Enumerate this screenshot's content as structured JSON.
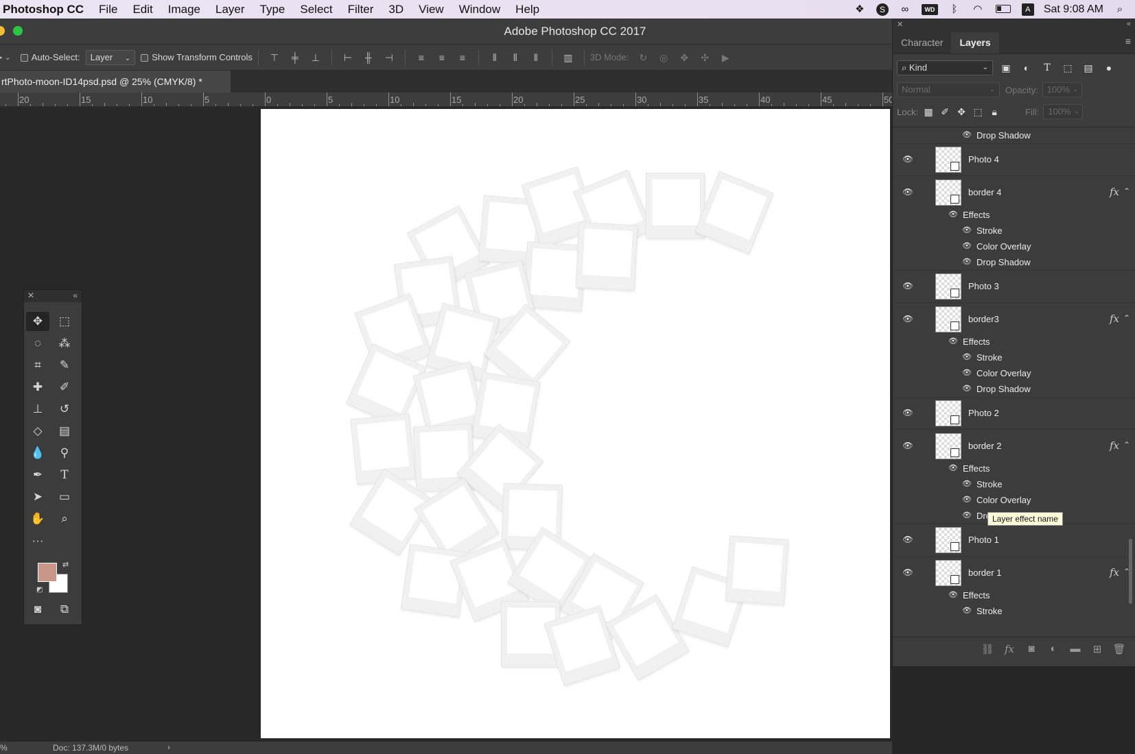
{
  "menubar": {
    "app": "Photoshop CC",
    "items": [
      "File",
      "Edit",
      "Image",
      "Layer",
      "Type",
      "Select",
      "Filter",
      "3D",
      "View",
      "Window",
      "Help"
    ],
    "clock": "Sat 9:08 AM"
  },
  "window": {
    "title": "Adobe Photoshop CC 2017"
  },
  "options": {
    "auto_select_label": "Auto-Select:",
    "auto_select_value": "Layer",
    "show_transform_label": "Show Transform Controls",
    "mode_3d_label": "3D Mode:"
  },
  "document": {
    "tab_title": "rtPhoto-moon-ID14psd.psd @ 25% (CMYK/8) *",
    "status": "Doc: 137.3M/0 bytes",
    "zoom": "%"
  },
  "ruler": {
    "labels": [
      "20",
      "15",
      "10",
      "5",
      "0",
      "5",
      "10",
      "15",
      "20",
      "25",
      "30",
      "35",
      "40",
      "45",
      "50"
    ]
  },
  "panel": {
    "tabs": [
      "Character",
      "Layers"
    ],
    "active_tab": "Layers",
    "filter_kind": "Kind",
    "blend_mode": "Normal",
    "opacity_label": "Opacity:",
    "opacity_value": "100%",
    "lock_label": "Lock:",
    "fill_label": "Fill:",
    "fill_value": "100%"
  },
  "layers": {
    "top_partial_effect": "Drop Shadow",
    "rows": [
      {
        "name": "Photo 4"
      },
      {
        "name": "border 4",
        "fx": "fx",
        "effects_label": "Effects",
        "effects": [
          "Stroke",
          "Color Overlay",
          "Drop Shadow"
        ]
      },
      {
        "name": "Photo 3"
      },
      {
        "name": "border3",
        "fx": "fx",
        "effects_label": "Effects",
        "effects": [
          "Stroke",
          "Color Overlay",
          "Drop Shadow"
        ]
      },
      {
        "name": "Photo 2"
      },
      {
        "name": "border 2",
        "fx": "fx",
        "effects_label": "Effects",
        "effects": [
          "Stroke",
          "Color Overlay",
          "Drop Shadow"
        ]
      },
      {
        "name": "Photo 1"
      },
      {
        "name": "border 1",
        "fx": "fx",
        "effects_label": "Effects",
        "effects": [
          "Stroke"
        ]
      }
    ]
  },
  "tooltip": "Layer effect name",
  "colors": {
    "foreground": "#c9978a",
    "background": "#ffffff",
    "panel_bg": "#3c3c3c"
  }
}
